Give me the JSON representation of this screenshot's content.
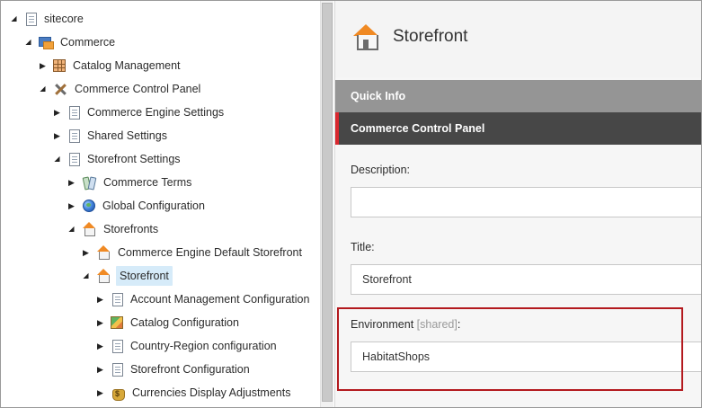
{
  "tree": {
    "nodes": [
      {
        "label": "sitecore",
        "icon": "document-icon",
        "expander": "open"
      },
      {
        "label": "Commerce",
        "icon": "commerce-icon",
        "expander": "open"
      },
      {
        "label": "Catalog Management",
        "icon": "catalog-grid-icon",
        "expander": "closed"
      },
      {
        "label": "Commerce Control Panel",
        "icon": "tools-icon",
        "expander": "open"
      },
      {
        "label": "Commerce Engine Settings",
        "icon": "document-icon",
        "expander": "closed"
      },
      {
        "label": "Shared Settings",
        "icon": "document-icon",
        "expander": "closed"
      },
      {
        "label": "Storefront Settings",
        "icon": "document-icon",
        "expander": "open"
      },
      {
        "label": "Commerce Terms",
        "icon": "terms-icon",
        "expander": "closed"
      },
      {
        "label": "Global Configuration",
        "icon": "globe-icon",
        "expander": "closed"
      },
      {
        "label": "Storefronts",
        "icon": "house-icon",
        "expander": "open"
      },
      {
        "label": "Commerce Engine Default Storefront",
        "icon": "house-icon",
        "expander": "closed"
      },
      {
        "label": "Storefront",
        "icon": "house-icon",
        "expander": "open",
        "selected": true
      },
      {
        "label": "Account Management Configuration",
        "icon": "document-icon",
        "expander": "closed"
      },
      {
        "label": "Catalog Configuration",
        "icon": "catalog-config-icon",
        "expander": "closed"
      },
      {
        "label": "Country-Region configuration",
        "icon": "document-icon",
        "expander": "closed"
      },
      {
        "label": "Storefront Configuration",
        "icon": "document-icon",
        "expander": "closed"
      },
      {
        "label": "Currencies Display Adjustments",
        "icon": "money-bag-icon",
        "expander": "closed"
      }
    ]
  },
  "content": {
    "title": "Storefront",
    "title_icon": "house-icon",
    "sections": {
      "quick_info": "Quick Info",
      "control_panel": "Commerce Control Panel"
    },
    "fields": {
      "description": {
        "label": "Description:",
        "value": ""
      },
      "title": {
        "label": "Title:",
        "value": "Storefront"
      },
      "environment": {
        "label": "Environment",
        "shared": "[shared]",
        "colon": ":",
        "value": "HabitatShops"
      }
    }
  },
  "colors": {
    "accent_red": "#d9282f",
    "highlight_box": "#b3191e",
    "quick_info_bar": "#959595",
    "section_bar": "#474747",
    "selection": "#d6ebf9",
    "house_roof": "#f08a24"
  }
}
